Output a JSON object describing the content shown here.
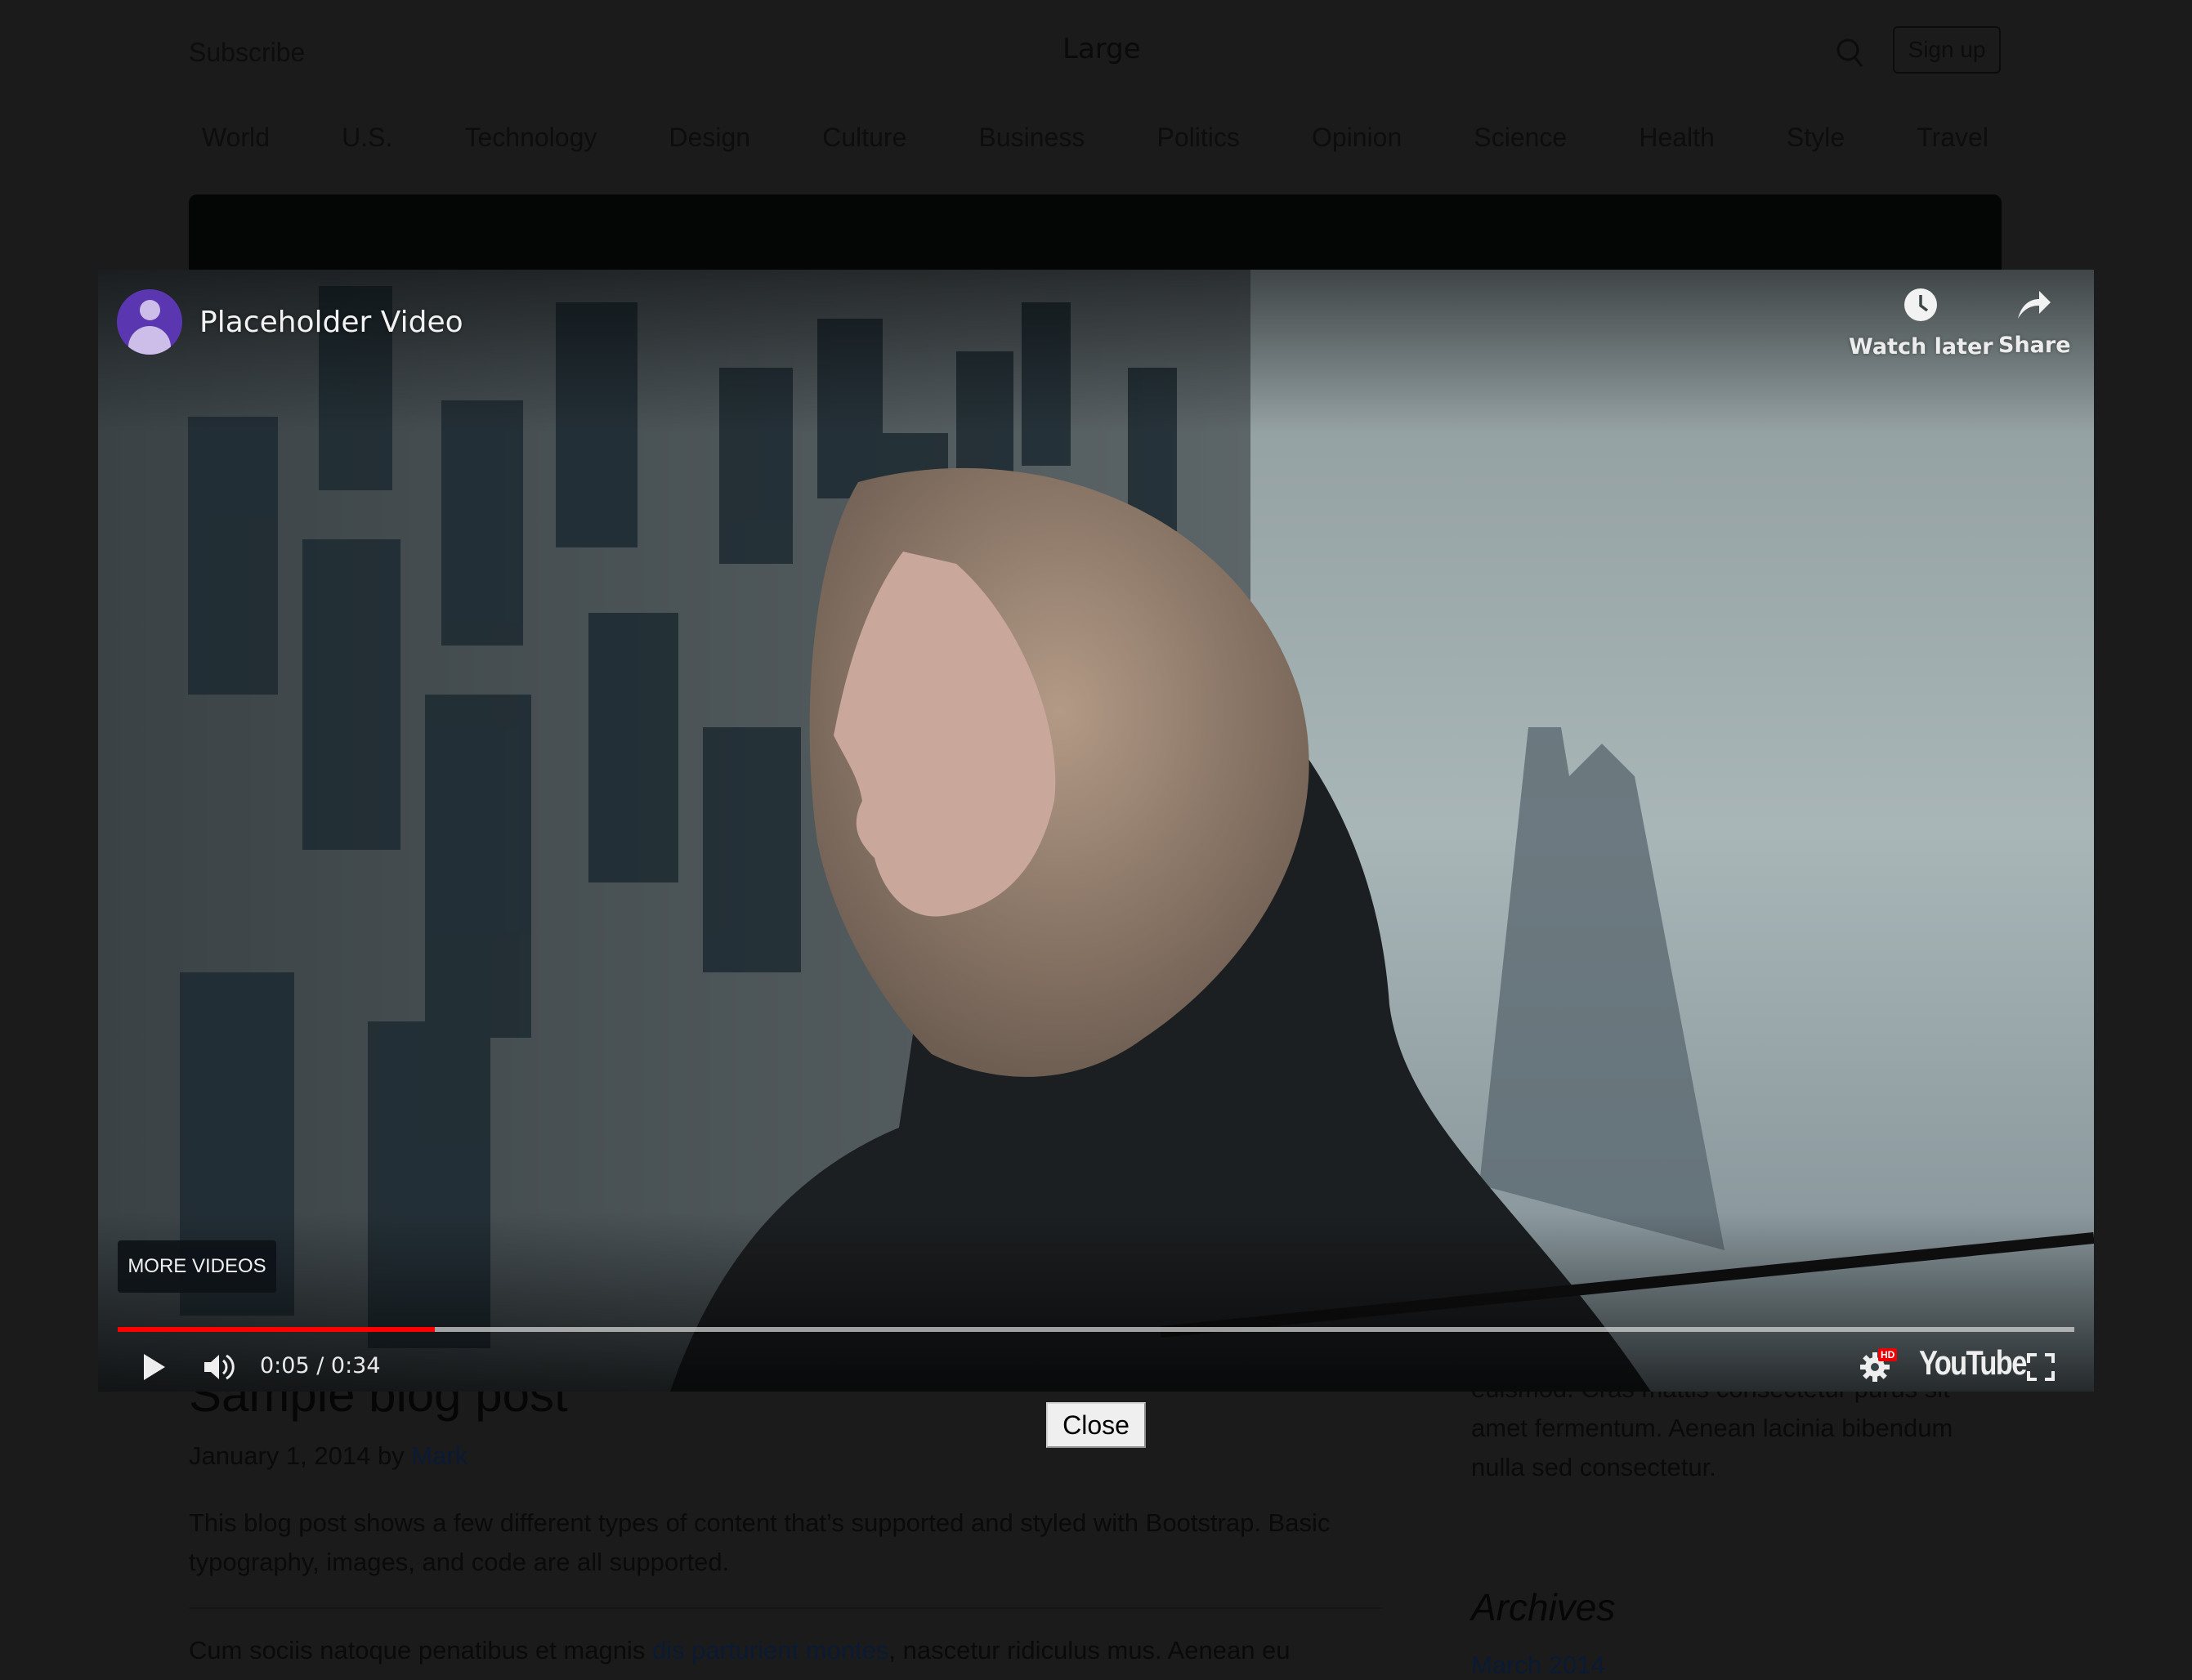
{
  "header": {
    "subscribe_label": "Subscribe",
    "brand": "Large",
    "search_icon": "search-icon",
    "signup_label": "Sign up"
  },
  "nav": {
    "items": [
      "World",
      "U.S.",
      "Technology",
      "Design",
      "Culture",
      "Business",
      "Politics",
      "Opinion",
      "Science",
      "Health",
      "Style",
      "Travel"
    ]
  },
  "post": {
    "title": "Sample blog post",
    "date_prefix": "January 1, 2014 by ",
    "author": "Mark",
    "lead": "This blog post shows a few different types of content that’s supported and styled with Bootstrap. Basic typography, images, and code are all supported.",
    "para_start": "Cum sociis natoque penatibus et magnis ",
    "para_link": "dis parturient montes",
    "para_end": ", nascetur ridiculus mus. Aenean eu"
  },
  "sidebar": {
    "about_text": "euismod. Cras mattis consectetur purus sit amet fermentum. Aenean lacinia bibendum nulla sed consectetur.",
    "archives_title": "Archives",
    "archive_link": "March 2014"
  },
  "video": {
    "title": "Placeholder Video",
    "channel_avatar_icon": "person-icon",
    "watch_later_label": "Watch later",
    "share_label": "Share",
    "more_videos_label": "MORE VIDEOS",
    "current_time": "0:05",
    "duration": "0:34",
    "time_display": "0:05 / 0:34",
    "progress_fraction": 0.162,
    "hd_badge": "HD",
    "logo_text": "YouTube",
    "progress_color": "#ff0000",
    "avatar_color": "#5a36b0"
  },
  "modal": {
    "close_label": "Close"
  }
}
